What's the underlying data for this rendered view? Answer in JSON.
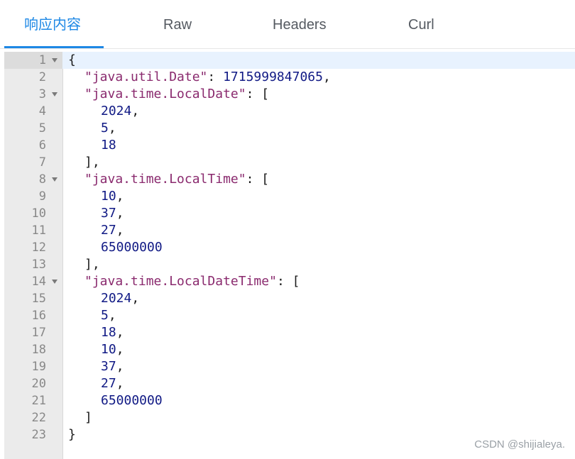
{
  "tabs": [
    {
      "label": "响应内容",
      "active": true
    },
    {
      "label": "Raw",
      "active": false
    },
    {
      "label": "Headers",
      "active": false
    },
    {
      "label": "Curl",
      "active": false
    }
  ],
  "accent_color": "#1e88e5",
  "editor": {
    "lines": [
      {
        "n": "1",
        "fold": true,
        "parts": [
          [
            "punct",
            "{"
          ]
        ]
      },
      {
        "n": "2",
        "fold": false,
        "indent": 1,
        "parts": [
          [
            "key",
            "\"java.util.Date\""
          ],
          [
            "punct",
            ": "
          ],
          [
            "num",
            "1715999847065"
          ],
          [
            "punct",
            ","
          ]
        ]
      },
      {
        "n": "3",
        "fold": true,
        "indent": 1,
        "parts": [
          [
            "key",
            "\"java.time.LocalDate\""
          ],
          [
            "punct",
            ": ["
          ]
        ]
      },
      {
        "n": "4",
        "fold": false,
        "indent": 2,
        "parts": [
          [
            "num",
            "2024"
          ],
          [
            "punct",
            ","
          ]
        ]
      },
      {
        "n": "5",
        "fold": false,
        "indent": 2,
        "parts": [
          [
            "num",
            "5"
          ],
          [
            "punct",
            ","
          ]
        ]
      },
      {
        "n": "6",
        "fold": false,
        "indent": 2,
        "parts": [
          [
            "num",
            "18"
          ]
        ]
      },
      {
        "n": "7",
        "fold": false,
        "indent": 1,
        "parts": [
          [
            "punct",
            "],"
          ]
        ]
      },
      {
        "n": "8",
        "fold": true,
        "indent": 1,
        "parts": [
          [
            "key",
            "\"java.time.LocalTime\""
          ],
          [
            "punct",
            ": ["
          ]
        ]
      },
      {
        "n": "9",
        "fold": false,
        "indent": 2,
        "parts": [
          [
            "num",
            "10"
          ],
          [
            "punct",
            ","
          ]
        ]
      },
      {
        "n": "10",
        "fold": false,
        "indent": 2,
        "parts": [
          [
            "num",
            "37"
          ],
          [
            "punct",
            ","
          ]
        ]
      },
      {
        "n": "11",
        "fold": false,
        "indent": 2,
        "parts": [
          [
            "num",
            "27"
          ],
          [
            "punct",
            ","
          ]
        ]
      },
      {
        "n": "12",
        "fold": false,
        "indent": 2,
        "parts": [
          [
            "num",
            "65000000"
          ]
        ]
      },
      {
        "n": "13",
        "fold": false,
        "indent": 1,
        "parts": [
          [
            "punct",
            "],"
          ]
        ]
      },
      {
        "n": "14",
        "fold": true,
        "indent": 1,
        "parts": [
          [
            "key",
            "\"java.time.LocalDateTime\""
          ],
          [
            "punct",
            ": ["
          ]
        ]
      },
      {
        "n": "15",
        "fold": false,
        "indent": 2,
        "parts": [
          [
            "num",
            "2024"
          ],
          [
            "punct",
            ","
          ]
        ]
      },
      {
        "n": "16",
        "fold": false,
        "indent": 2,
        "parts": [
          [
            "num",
            "5"
          ],
          [
            "punct",
            ","
          ]
        ]
      },
      {
        "n": "17",
        "fold": false,
        "indent": 2,
        "parts": [
          [
            "num",
            "18"
          ],
          [
            "punct",
            ","
          ]
        ]
      },
      {
        "n": "18",
        "fold": false,
        "indent": 2,
        "parts": [
          [
            "num",
            "10"
          ],
          [
            "punct",
            ","
          ]
        ]
      },
      {
        "n": "19",
        "fold": false,
        "indent": 2,
        "parts": [
          [
            "num",
            "37"
          ],
          [
            "punct",
            ","
          ]
        ]
      },
      {
        "n": "20",
        "fold": false,
        "indent": 2,
        "parts": [
          [
            "num",
            "27"
          ],
          [
            "punct",
            ","
          ]
        ]
      },
      {
        "n": "21",
        "fold": false,
        "indent": 2,
        "parts": [
          [
            "num",
            "65000000"
          ]
        ]
      },
      {
        "n": "22",
        "fold": false,
        "indent": 1,
        "parts": [
          [
            "punct",
            "]"
          ]
        ]
      },
      {
        "n": "23",
        "fold": false,
        "parts": [
          [
            "punct",
            "}"
          ]
        ]
      }
    ],
    "active_line": "1"
  },
  "watermark": "CSDN @shijialeya."
}
